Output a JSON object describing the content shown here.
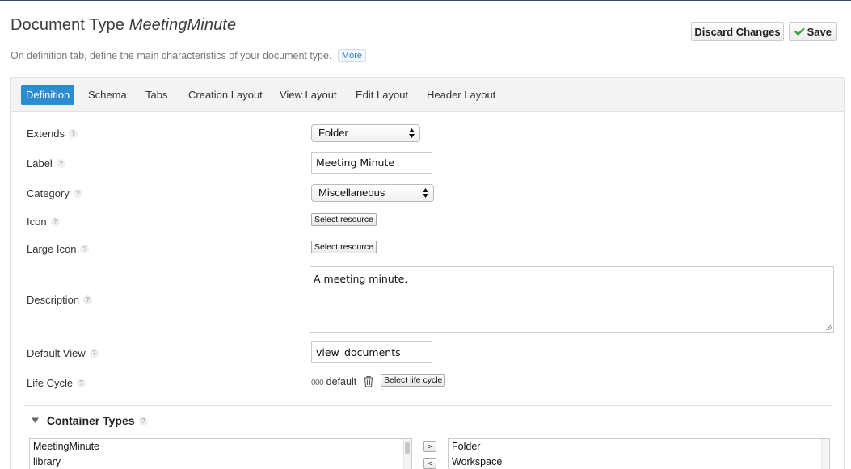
{
  "header": {
    "title_prefix": "Document Type",
    "title_name": "MeetingMinute",
    "subtitle": "On definition tab, define the main characteristics of your document type.",
    "more_label": "More",
    "discard_label": "Discard Changes",
    "save_label": "Save",
    "accent_color": "#2d8bd0",
    "save_icon_color": "#3aa335"
  },
  "tabs": [
    {
      "label": "Definition",
      "active": true
    },
    {
      "label": "Schema"
    },
    {
      "label": "Tabs"
    },
    {
      "label": "Creation Layout"
    },
    {
      "label": "View Layout"
    },
    {
      "label": "Edit Layout"
    },
    {
      "label": "Header Layout"
    }
  ],
  "form": {
    "help_glyph": "?",
    "extends": {
      "label": "Extends",
      "value": "Folder"
    },
    "label": {
      "label": "Label",
      "value": "Meeting Minute"
    },
    "category": {
      "label": "Category",
      "value": "Miscellaneous"
    },
    "icon": {
      "label": "Icon",
      "button": "Select resource"
    },
    "large_icon": {
      "label": "Large Icon",
      "button": "Select resource"
    },
    "description": {
      "label": "Description",
      "value": "A meeting minute."
    },
    "default_view": {
      "label": "Default View",
      "value": "view_documents"
    },
    "life_cycle": {
      "label": "Life Cycle",
      "zeros": "000",
      "value": "default",
      "button": "Select life cycle"
    }
  },
  "container_types": {
    "title": "Container Types",
    "available": [
      "MeetingMinute",
      "library"
    ],
    "selected": [
      "Folder",
      "Workspace"
    ],
    "add_label": ">",
    "remove_label": "<"
  }
}
